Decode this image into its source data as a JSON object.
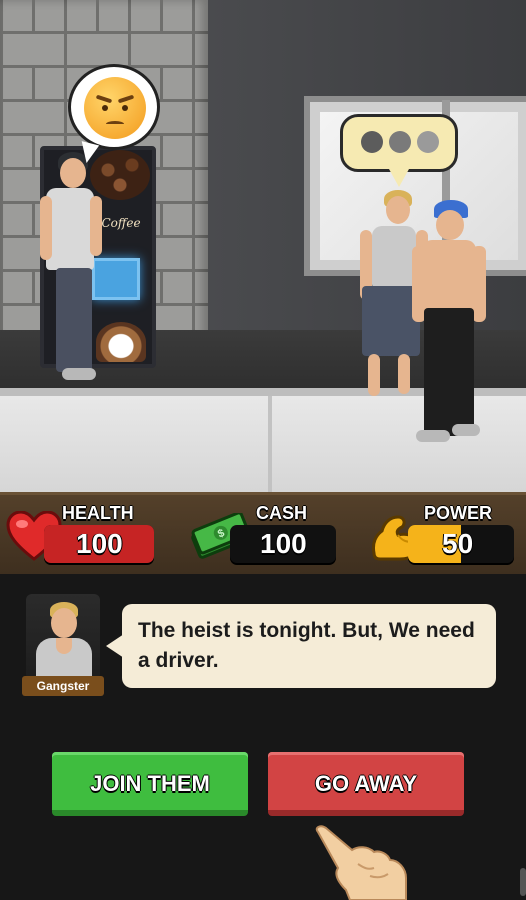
{
  "scene": {
    "npc_left_emotion": "angry-face-icon",
    "npc_mid_bubble": "typing-dots-icon",
    "coffee_brand": "Coffee"
  },
  "hud": {
    "health": {
      "label": "HEALTH",
      "value": "100",
      "fill": 1.0,
      "color": "#c62424",
      "icon": "heart-icon"
    },
    "cash": {
      "label": "CASH",
      "value": "100",
      "fill": 0.0,
      "color": "#111111",
      "icon": "cash-icon"
    },
    "power": {
      "label": "POWER",
      "value": "50",
      "fill": 0.5,
      "color": "#f5b31a",
      "icon": "muscle-icon"
    }
  },
  "dialog": {
    "speaker": "Gangster",
    "text": "The heist is tonight. But, We need a driver."
  },
  "choices": {
    "join": "JOIN THEM",
    "away": "GO AWAY"
  },
  "hint": {
    "icon": "pointing-hand-icon"
  }
}
